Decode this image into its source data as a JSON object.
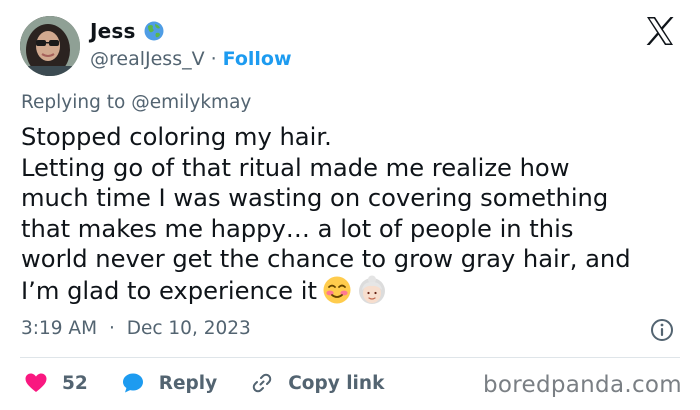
{
  "user": {
    "name": "Jess",
    "handle": "@realJess_V",
    "separator": "·",
    "follow_label": "Follow",
    "badge_icon": "globe-icon"
  },
  "reply": {
    "prefix": "Replying to",
    "to": "@emilykmay"
  },
  "tweet": {
    "lines": [
      "Stopped coloring my hair.",
      "Letting go of that ritual made me realize how",
      "much time I was wasting on covering something",
      "that makes me happy… a lot of people in this",
      "world never get the chance to grow gray hair, and",
      "I’m glad to experience it"
    ],
    "emojis": [
      "smiling-face-with-rosy-cheeks-emoji",
      "older-woman-emoji"
    ]
  },
  "meta": {
    "time": "3:19 AM",
    "separator": "·",
    "date": "Dec 10, 2023"
  },
  "actions": {
    "likes_count": "52",
    "reply_label": "Reply",
    "copy_link_label": "Copy link"
  },
  "watermark": "boredpanda.com",
  "colors": {
    "accent": "#1d9bf0",
    "like": "#f91880",
    "muted": "#536471",
    "text": "#0f1419"
  }
}
